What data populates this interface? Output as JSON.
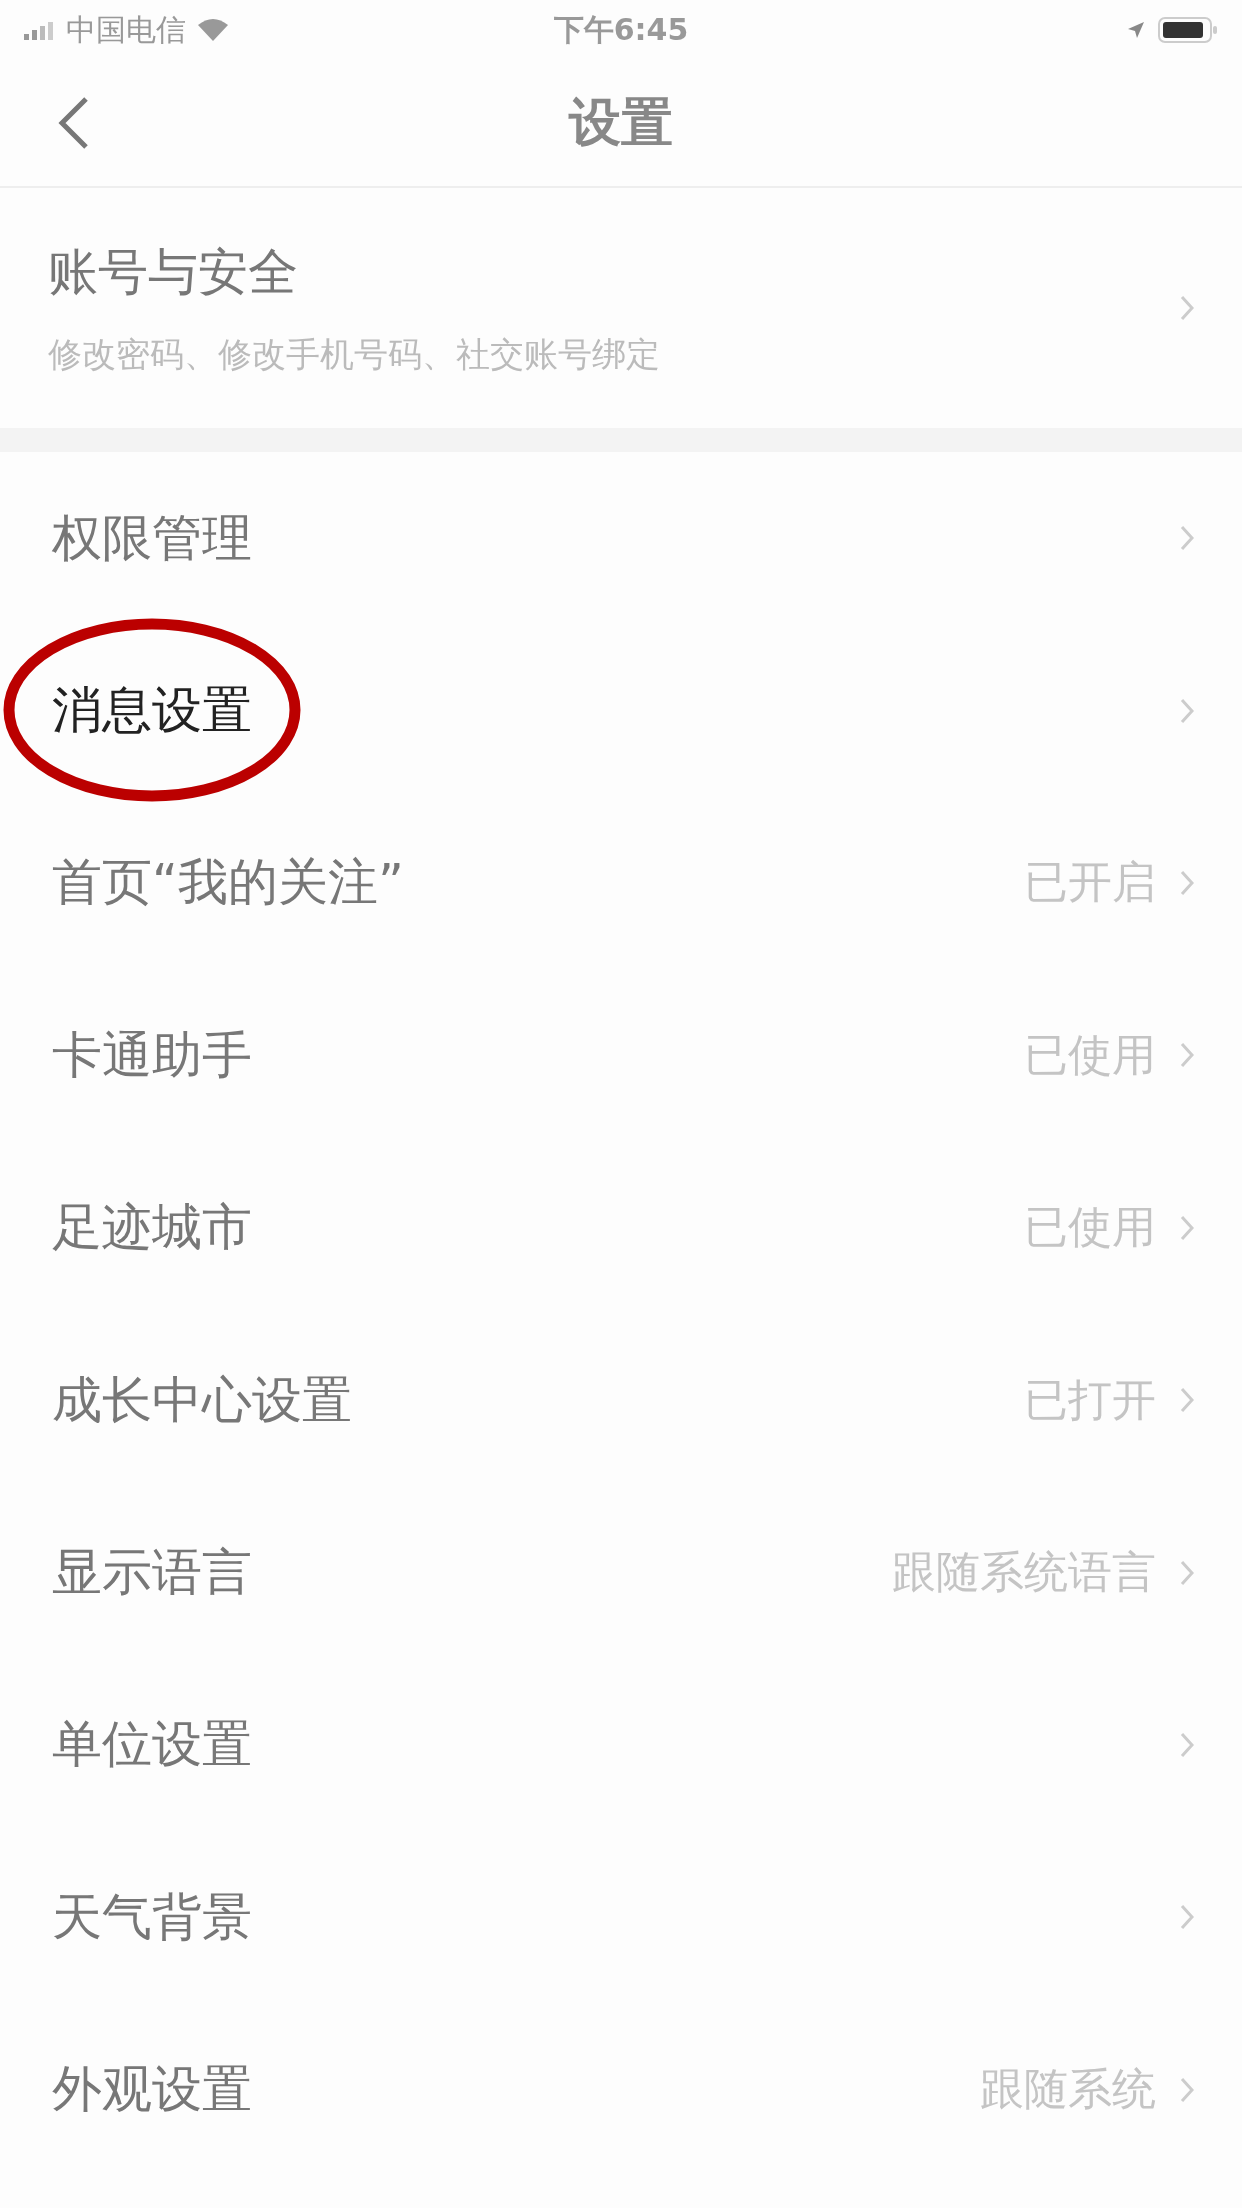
{
  "status_bar": {
    "carrier": "中国电信",
    "time": "下午6:45"
  },
  "nav": {
    "title": "设置"
  },
  "account": {
    "title": "账号与安全",
    "subtitle": "修改密码、修改手机号码、社交账号绑定"
  },
  "items": [
    {
      "label": "权限管理",
      "highlighted": false
    },
    {
      "label": "消息设置",
      "highlighted": true
    },
    {
      "label": "首页“我的关注”",
      "value": "已开启",
      "highlighted": false
    },
    {
      "label": "卡通助手",
      "value": "已使用",
      "highlighted": false
    },
    {
      "label": "足迹城市",
      "value": "已使用",
      "highlighted": false
    },
    {
      "label": "成长中心设置",
      "value": "已打开",
      "highlighted": false
    },
    {
      "label": "显示语言",
      "value": "跟随系统语言",
      "highlighted": false
    },
    {
      "label": "单位设置",
      "highlighted": false
    },
    {
      "label": "天气背景",
      "highlighted": false
    },
    {
      "label": "外观设置",
      "value": "跟随系统",
      "highlighted": false
    }
  ]
}
